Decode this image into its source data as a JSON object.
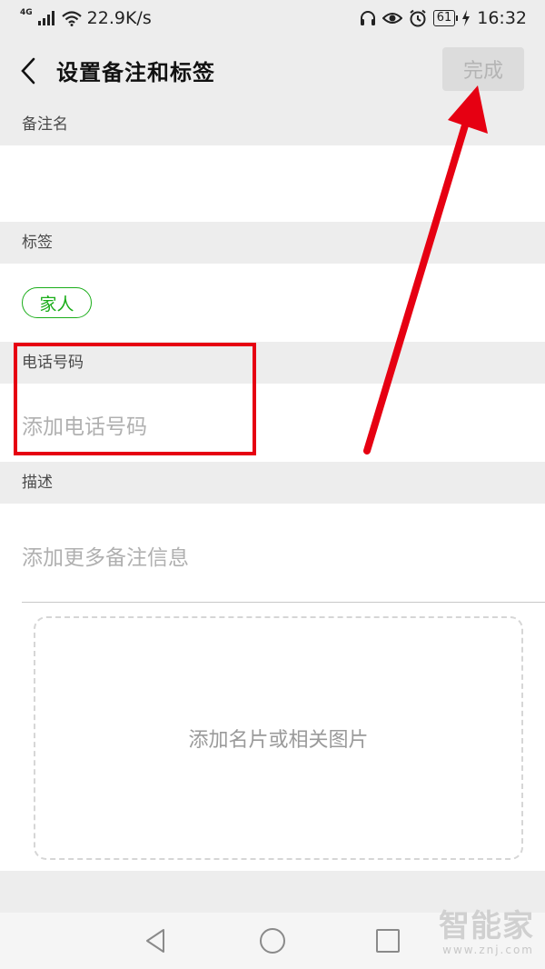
{
  "status_bar": {
    "network_type": "4G",
    "speed": "22.9K/s",
    "battery": "61",
    "time": "16:32"
  },
  "header": {
    "title": "设置备注和标签",
    "done_label": "完成"
  },
  "sections": {
    "remark": {
      "label": "备注名"
    },
    "tags": {
      "label": "标签",
      "items": [
        "家人"
      ]
    },
    "phone": {
      "label": "电话号码",
      "placeholder": "添加电话号码"
    },
    "description": {
      "label": "描述",
      "placeholder": "添加更多备注信息"
    }
  },
  "upload": {
    "label": "添加名片或相关图片"
  },
  "watermark": {
    "brand": "智能家",
    "url": "www.znj.com"
  },
  "colors": {
    "accent_green": "#1aad19",
    "annotation_red": "#e60012",
    "background": "#ededed"
  }
}
